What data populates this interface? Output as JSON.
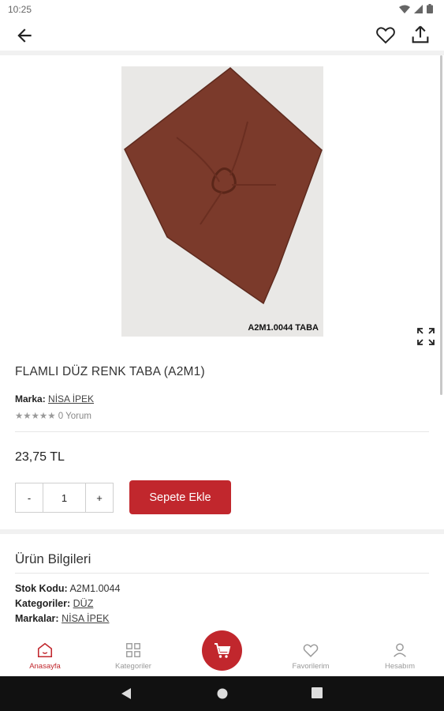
{
  "status_bar": {
    "time": "10:25"
  },
  "product": {
    "title": "FLAMLI DÜZ RENK TABA (A2M1)",
    "image_caption": "A2M1.0044 TABA",
    "brand_label": "Marka:",
    "brand_value": "NİSA İPEK",
    "stars": "★★★★★",
    "reviews": "0 Yorum",
    "price": "23,75 TL",
    "qty_minus": "-",
    "qty_value": "1",
    "qty_plus": "+",
    "add_to_cart": "Sepete Ekle"
  },
  "info": {
    "title": "Ürün Bilgileri",
    "stock_label": "Stok Kodu:",
    "stock_value": "A2M1.0044",
    "category_label": "Kategoriler:",
    "category_value": "DÜZ",
    "brands_label": "Markalar:",
    "brands_value": "NİSA İPEK"
  },
  "bottom_nav": {
    "home": "Anasayfa",
    "categories": "Kategoriler",
    "favorites": "Favorilerim",
    "account": "Hesabım"
  },
  "colors": {
    "accent": "#c1272d",
    "scarf": "#7b3a2b"
  }
}
